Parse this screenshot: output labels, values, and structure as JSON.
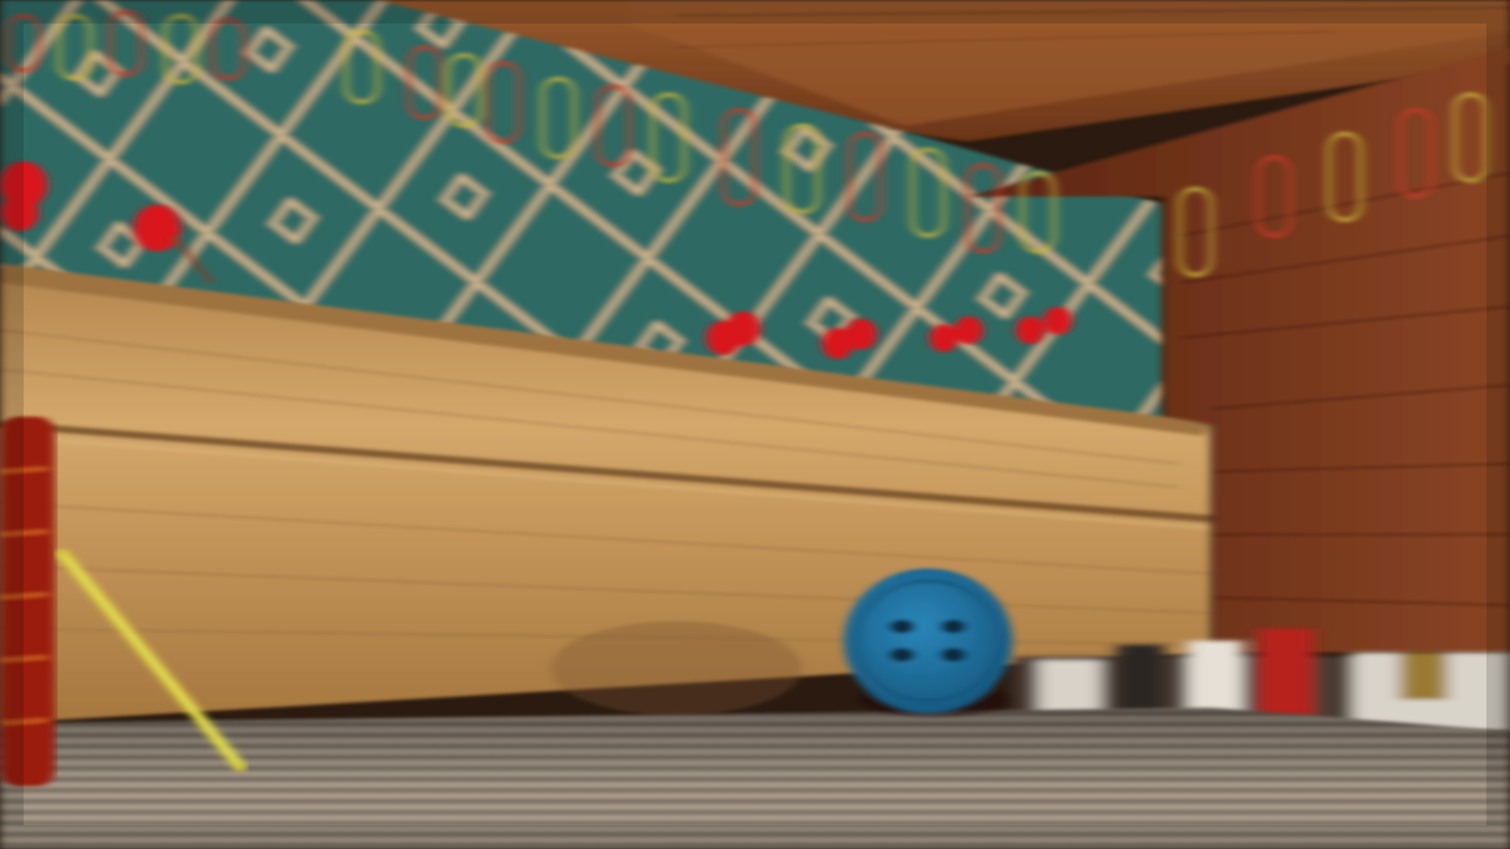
{
  "scene": {
    "description_visible_text": "",
    "colors": {
      "ceiling_wood": "#8a4a22",
      "ceiling_wood_dark": "#5a2c14",
      "wallpaper_teal": "#2f6a63",
      "wallpaper_lines": "#c9b08a",
      "shelf_wood": "#c9995e",
      "shelf_wood_dark": "#8b6036",
      "right_wall_wood": "#6e2f16",
      "floor_fabric": "#8d8175",
      "button_blue": "#1f6f9c",
      "pushpin_red": "#d8141a",
      "paperclip_red": "#c83a2a",
      "paperclip_yellow": "#c8b63a",
      "needle_yellow": "#d9d23a",
      "spool_red": "#9a1f10"
    },
    "objects": [
      "ceiling-plank",
      "patterned-wallpaper",
      "paperclip-chain",
      "pushpins",
      "wooden-shelf-board",
      "right-wood-wall",
      "blue-sewing-button",
      "yellow-needle",
      "red-thread-spool",
      "woven-fabric-floor",
      "clutter-under-shelf"
    ]
  }
}
